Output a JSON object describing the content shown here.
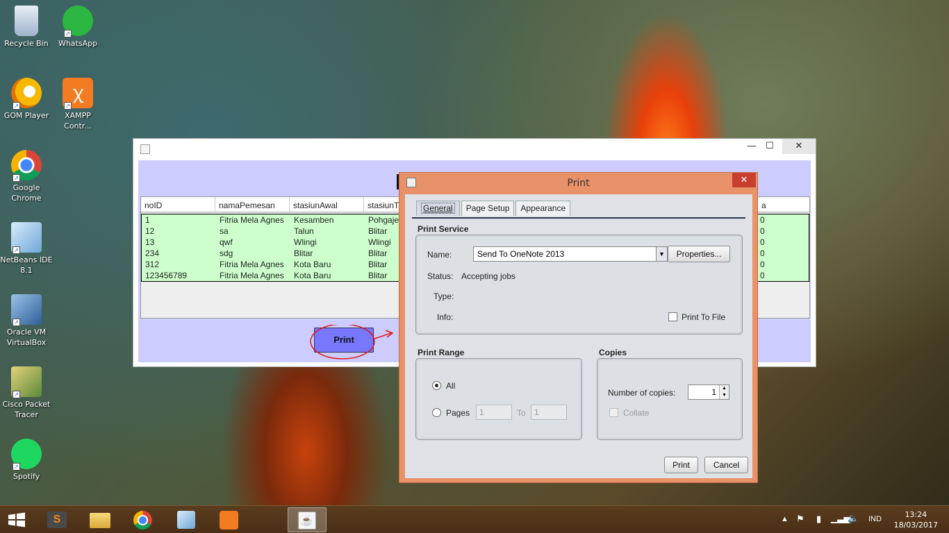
{
  "desktop": {
    "icons": [
      {
        "label": "Recycle Bin",
        "icon": "recycle-bin-icon"
      },
      {
        "label": "WhatsApp",
        "icon": "whatsapp-icon"
      },
      {
        "label": "GOM Player",
        "icon": "gom-player-icon"
      },
      {
        "label": "XAMPP Contr...",
        "icon": "xampp-icon"
      },
      {
        "label": "Google Chrome",
        "icon": "chrome-icon"
      },
      {
        "label": "NetBeans IDE 8.1",
        "icon": "netbeans-icon"
      },
      {
        "label": "Oracle VM VirtualBox",
        "icon": "virtualbox-icon"
      },
      {
        "label": "Cisco Packet Tracer",
        "icon": "packet-tracer-icon"
      },
      {
        "label": "Spotify",
        "icon": "spotify-icon"
      }
    ]
  },
  "main_window": {
    "table": {
      "columns": [
        "noID",
        "namaPemesan",
        "stasiunAwal",
        "stasiunT"
      ],
      "last_column_fragment": "a",
      "rows": [
        {
          "noID": "1",
          "nama": "Fitria Mela Agnes",
          "awal": "Kesamben",
          "tujuan": "Pohgaje",
          "last": "0"
        },
        {
          "noID": "12",
          "nama": "sa",
          "awal": "Talun",
          "tujuan": "Blitar",
          "last": "0"
        },
        {
          "noID": "13",
          "nama": "qwf",
          "awal": "Wlingi",
          "tujuan": "Wlingi",
          "last": "0"
        },
        {
          "noID": "234",
          "nama": "sdg",
          "awal": "Blitar",
          "tujuan": "Blitar",
          "last": "0"
        },
        {
          "noID": "312",
          "nama": "Fitria Mela Agnes",
          "awal": "Kota Baru",
          "tujuan": "Blitar",
          "last": "0"
        },
        {
          "noID": "123456789",
          "nama": "Fitria Mela Agnes",
          "awal": "Kota Baru",
          "tujuan": "Blitar",
          "last": "0"
        }
      ]
    },
    "print_button": "Print",
    "controls": {
      "minimize": "—",
      "maximize": "☐",
      "close": "✕"
    }
  },
  "print_dialog": {
    "title": "Print",
    "close": "✕",
    "tabs": [
      "General",
      "Page Setup",
      "Appearance"
    ],
    "print_service": {
      "section": "Print Service",
      "name_label": "Name:",
      "name_value": "Send To OneNote 2013",
      "properties_button": "Properties...",
      "status_label": "Status:",
      "status_value": "Accepting jobs",
      "type_label": "Type:",
      "info_label": "Info:",
      "print_to_file": "Print To File"
    },
    "print_range": {
      "section": "Print Range",
      "all": "All",
      "pages": "Pages",
      "from": "1",
      "to_label": "To",
      "to": "1"
    },
    "copies": {
      "section": "Copies",
      "number_label": "Number of copies:",
      "number_value": "1",
      "collate": "Collate"
    },
    "print_button": "Print",
    "cancel_button": "Cancel"
  },
  "taskbar": {
    "language": "IND",
    "time": "13:24",
    "date": "18/03/2017"
  }
}
